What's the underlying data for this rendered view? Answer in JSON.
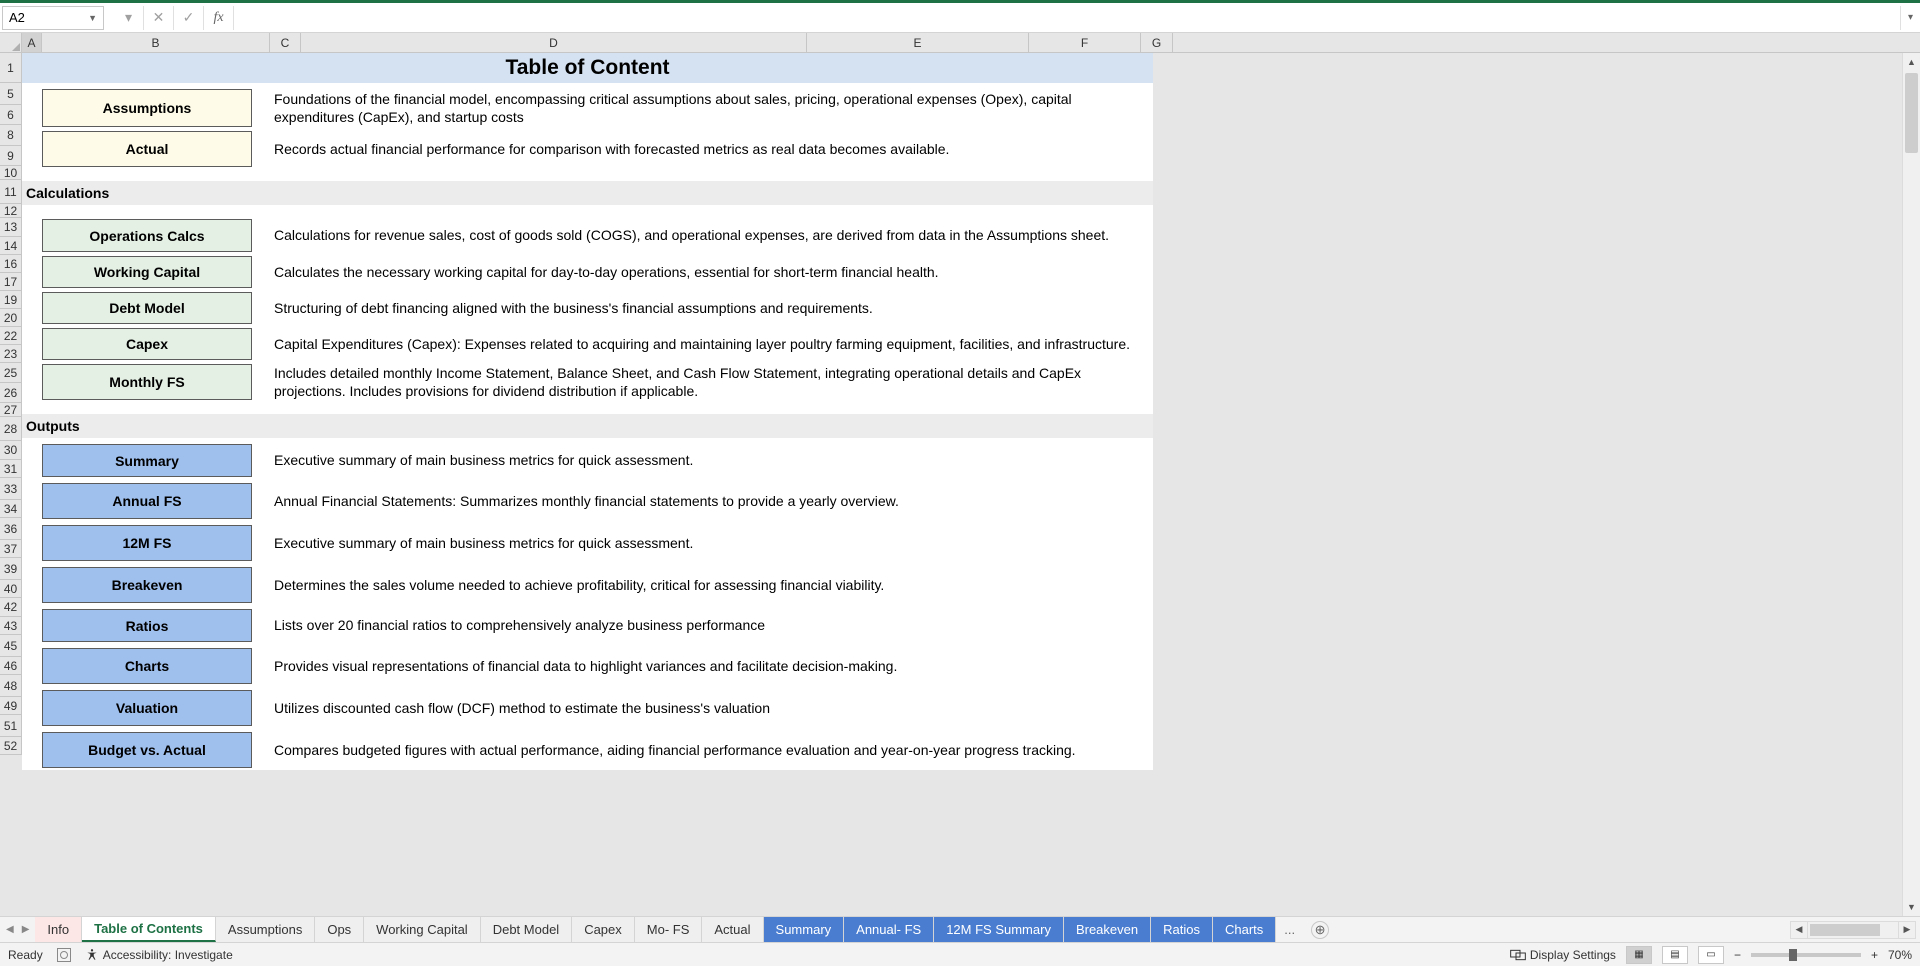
{
  "nameBox": "A2",
  "title": "Table of Content",
  "columns": [
    "A",
    "B",
    "C",
    "D",
    "E",
    "F",
    "G"
  ],
  "rowHeaders": [
    1,
    5,
    6,
    8,
    9,
    10,
    11,
    12,
    13,
    14,
    16,
    17,
    19,
    20,
    22,
    23,
    25,
    26,
    27,
    28,
    30,
    31,
    33,
    34,
    36,
    37,
    39,
    40,
    42,
    43,
    45,
    46,
    48,
    49,
    51,
    52
  ],
  "sectionCalcs": "Calculations",
  "sectionOutputs": "Outputs",
  "items": {
    "assumptions": {
      "label": "Assumptions",
      "desc": "Foundations of the financial model, encompassing critical assumptions about sales, pricing, operational expenses (Opex), capital expenditures (CapEx), and startup costs"
    },
    "actual": {
      "label": "Actual",
      "desc": "Records actual financial performance for comparison with forecasted metrics as real data becomes available."
    },
    "opscalcs": {
      "label": "Operations Calcs",
      "desc": "Calculations for revenue sales, cost of goods sold (COGS), and operational expenses, are derived from data in the Assumptions sheet."
    },
    "wcap": {
      "label": "Working Capital",
      "desc": "Calculates the necessary working capital for day-to-day operations, essential for short-term financial health."
    },
    "debt": {
      "label": "Debt Model",
      "desc": "Structuring of debt financing aligned with the business's financial assumptions and requirements."
    },
    "capex": {
      "label": "Capex",
      "desc": "Capital Expenditures (Capex): Expenses related to acquiring and maintaining layer poultry farming equipment, facilities, and infrastructure."
    },
    "monthlyfs": {
      "label": "Monthly FS",
      "desc": "Includes detailed monthly Income Statement, Balance Sheet, and Cash Flow Statement, integrating operational details and CapEx projections. Includes provisions for dividend distribution if applicable."
    },
    "summary": {
      "label": "Summary",
      "desc": "Executive summary of main business metrics for quick assessment."
    },
    "annualfs": {
      "label": "Annual FS",
      "desc": "Annual Financial Statements: Summarizes monthly financial statements to provide a yearly overview."
    },
    "twelvemfs": {
      "label": "12M FS",
      "desc": "Executive summary of main business metrics for quick assessment."
    },
    "breakeven": {
      "label": "Breakeven",
      "desc": "Determines the sales volume needed to achieve profitability, critical for assessing financial viability."
    },
    "ratios": {
      "label": "Ratios",
      "desc": "Lists over 20 financial ratios to comprehensively analyze business performance"
    },
    "charts": {
      "label": "Charts",
      "desc": "Provides visual representations of financial data to highlight variances and facilitate decision-making."
    },
    "valuation": {
      "label": "Valuation",
      "desc": "Utilizes discounted cash flow (DCF) method to estimate the business's valuation"
    },
    "bva": {
      "label": "Budget vs. Actual",
      "desc": "Compares budgeted figures with actual performance, aiding financial performance evaluation and year-on-year progress tracking."
    }
  },
  "tabs": [
    "Info",
    "Table of Contents",
    "Assumptions",
    "Ops",
    "Working Capital",
    "Debt Model",
    "Capex",
    "Mo- FS",
    "Actual",
    "Summary",
    "Annual- FS",
    "12M FS Summary",
    "Breakeven",
    "Ratios",
    "Charts"
  ],
  "tabsMore": "...",
  "status": {
    "ready": "Ready",
    "accessibility": "Accessibility: Investigate",
    "displaySettings": "Display Settings",
    "zoom": "70%"
  }
}
